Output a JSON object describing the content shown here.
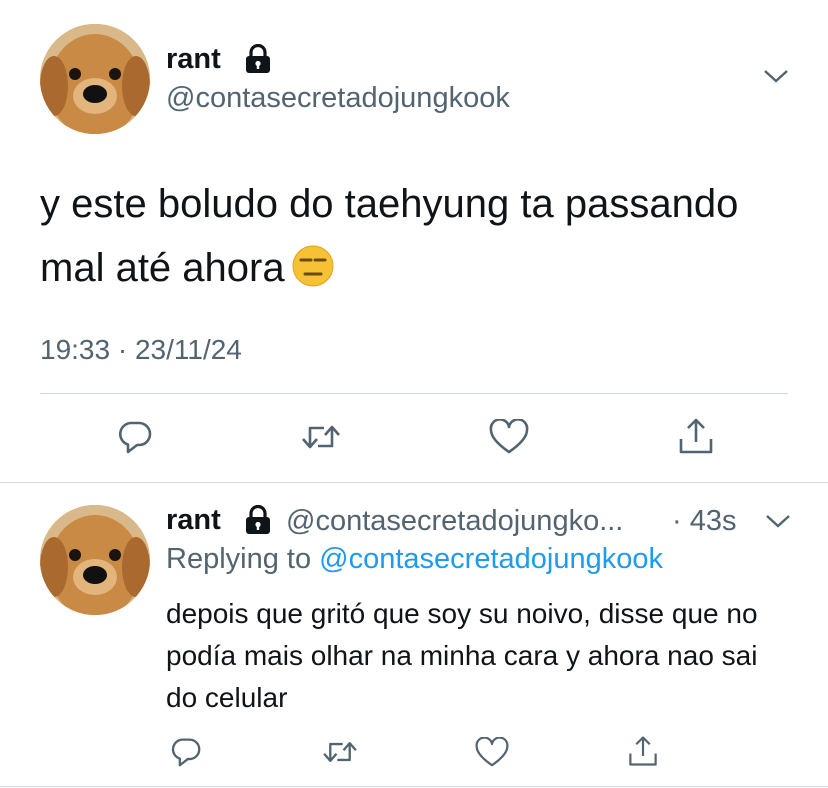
{
  "tweet": {
    "display_name": "rant",
    "handle": "@contasecretadojungkook",
    "text": "y este boludo do taehyung ta passando mal até ahora",
    "emoji": "expressionless-face",
    "timestamp": "19:33 · 23/11/24",
    "protected": true
  },
  "reply": {
    "display_name": "rant",
    "handle": "@contasecretadojungko...",
    "time": "· 43s",
    "replying_prefix": "Replying to",
    "replying_to": "@contasecretadojungkook",
    "text": "depois que gritó que soy su noivo, disse que no podía mais olhar na minha cara y ahora nao sai do celular"
  },
  "icons": {
    "reply": "reply-icon",
    "retweet": "retweet-icon",
    "like": "heart-icon",
    "share": "share-icon",
    "lock": "lock-icon",
    "more": "chevron-down-icon"
  },
  "colors": {
    "text": "#0f1419",
    "secondary": "#536471",
    "accent": "#1d9bf0",
    "divider": "#cfd9de"
  }
}
